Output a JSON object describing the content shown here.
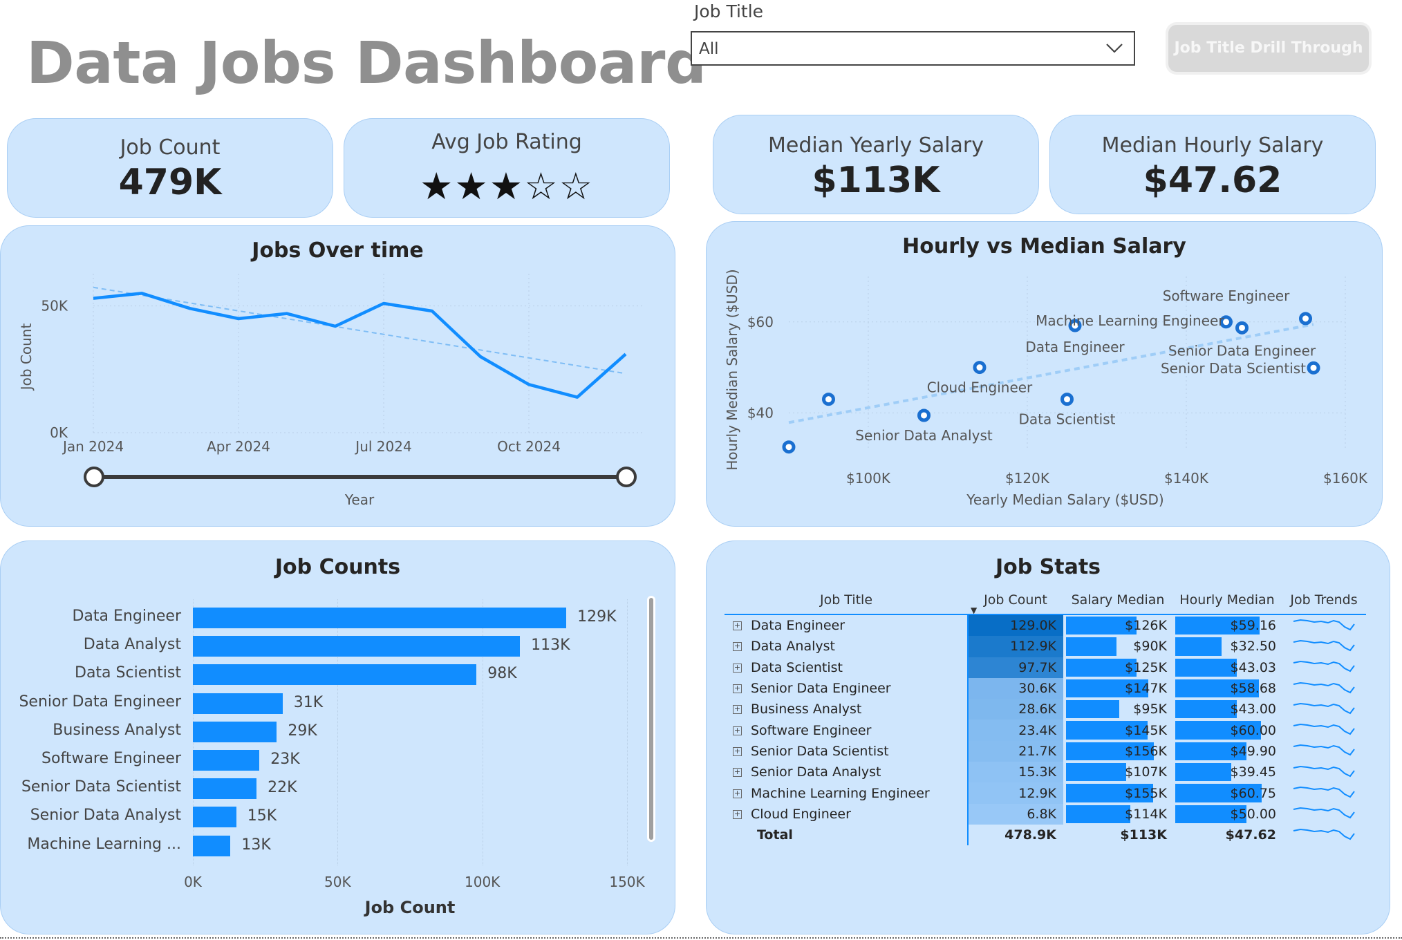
{
  "header": {
    "title": "Data Jobs Dashboard",
    "filter_label": "Job Title",
    "filter_value": "All",
    "drill_button": "Job Title Drill Through"
  },
  "kpis": {
    "job_count_label": "Job Count",
    "job_count_value": "479K",
    "rating_label": "Avg Job Rating",
    "rating_stars_filled": 3,
    "rating_stars_total": 5,
    "yearly_label": "Median Yearly Salary",
    "yearly_value": "$113K",
    "hourly_label": "Median Hourly Salary",
    "hourly_value": "$47.62"
  },
  "colors": {
    "accent": "#118dff",
    "card_bg": "#cfe6fd",
    "title_grey": "#8f8f8f"
  },
  "chart_data": [
    {
      "type": "line",
      "title": "Jobs Over time",
      "xlabel": "Year",
      "ylabel": "Job Count",
      "x": [
        "2024-01",
        "2024-02",
        "2024-03",
        "2024-04",
        "2024-05",
        "2024-06",
        "2024-07",
        "2024-08",
        "2024-09",
        "2024-10",
        "2024-11",
        "2024-12"
      ],
      "x_ticks": [
        "Jan 2024",
        "Apr 2024",
        "Jul 2024",
        "Oct 2024"
      ],
      "y_ticks": [
        "0K",
        "50K"
      ],
      "series": [
        {
          "values": [
            53000,
            55000,
            49000,
            45000,
            47000,
            42000,
            51000,
            48000,
            30000,
            19000,
            14000,
            31000
          ]
        }
      ],
      "trendline": true,
      "ylim": [
        0,
        60000
      ]
    },
    {
      "type": "scatter",
      "title": "Hourly vs Median Salary",
      "xlabel": "Yearly Median Salary ($USD)",
      "ylabel": "Hourly Median Salary ($USD)",
      "xlim": [
        90000,
        160000
      ],
      "ylim": [
        32,
        70
      ],
      "x_ticks": [
        "$100K",
        "$120K",
        "$140K",
        "$160K"
      ],
      "y_ticks": [
        "$40",
        "$60"
      ],
      "points": [
        {
          "label": "Data Engineer",
          "x": 126000,
          "y": 59.2
        },
        {
          "label": "Machine Learning Engineer",
          "x": 145000,
          "y": 60.0
        },
        {
          "label": "Software Engineer",
          "x": 155000,
          "y": 60.75
        },
        {
          "label": "Senior Data Engineer",
          "x": 147000,
          "y": 58.7
        },
        {
          "label": "Senior Data Scientist",
          "x": 156000,
          "y": 49.9
        },
        {
          "label": "Cloud Engineer",
          "x": 114000,
          "y": 50.0
        },
        {
          "label": "Data Scientist",
          "x": 125000,
          "y": 43.0
        },
        {
          "label": "Senior Data Analyst",
          "x": 107000,
          "y": 39.45
        },
        {
          "label": "",
          "x": 95000,
          "y": 43.0
        },
        {
          "label": "",
          "x": 90000,
          "y": 32.5
        }
      ],
      "trendline": true
    },
    {
      "type": "bar",
      "title": "Job Counts",
      "xlabel": "Job Count",
      "categories": [
        "Data Engineer",
        "Data Analyst",
        "Data Scientist",
        "Senior Data Engineer",
        "Business Analyst",
        "Software Engineer",
        "Senior Data Scientist",
        "Senior Data Analyst",
        "Machine Learning ..."
      ],
      "values": [
        129000,
        113000,
        98000,
        31000,
        29000,
        23000,
        22000,
        15000,
        13000
      ],
      "value_labels": [
        "129K",
        "113K",
        "98K",
        "31K",
        "29K",
        "23K",
        "22K",
        "15K",
        "13K"
      ],
      "x_ticks": [
        "0K",
        "50K",
        "100K",
        "150K"
      ],
      "xlim": [
        0,
        150000
      ]
    },
    {
      "type": "table",
      "title": "Job Stats",
      "columns": [
        "Job Title",
        "Job Count",
        "Salary Median",
        "Hourly Median",
        "Job Trends"
      ],
      "rows": [
        {
          "title": "Data Engineer",
          "count": "129.0K",
          "count_num": 129.0,
          "salary": "$126K",
          "salary_num": 126,
          "hourly": "$59.16",
          "hourly_num": 59.16
        },
        {
          "title": "Data Analyst",
          "count": "112.9K",
          "count_num": 112.9,
          "salary": "$90K",
          "salary_num": 90,
          "hourly": "$32.50",
          "hourly_num": 32.5
        },
        {
          "title": "Data Scientist",
          "count": "97.7K",
          "count_num": 97.7,
          "salary": "$125K",
          "salary_num": 125,
          "hourly": "$43.03",
          "hourly_num": 43.03
        },
        {
          "title": "Senior Data Engineer",
          "count": "30.6K",
          "count_num": 30.6,
          "salary": "$147K",
          "salary_num": 147,
          "hourly": "$58.68",
          "hourly_num": 58.68
        },
        {
          "title": "Business Analyst",
          "count": "28.6K",
          "count_num": 28.6,
          "salary": "$95K",
          "salary_num": 95,
          "hourly": "$43.00",
          "hourly_num": 43.0
        },
        {
          "title": "Software Engineer",
          "count": "23.4K",
          "count_num": 23.4,
          "salary": "$145K",
          "salary_num": 145,
          "hourly": "$60.00",
          "hourly_num": 60.0
        },
        {
          "title": "Senior Data Scientist",
          "count": "21.7K",
          "count_num": 21.7,
          "salary": "$156K",
          "salary_num": 156,
          "hourly": "$49.90",
          "hourly_num": 49.9
        },
        {
          "title": "Senior Data Analyst",
          "count": "15.3K",
          "count_num": 15.3,
          "salary": "$107K",
          "salary_num": 107,
          "hourly": "$39.45",
          "hourly_num": 39.45
        },
        {
          "title": "Machine Learning Engineer",
          "count": "12.9K",
          "count_num": 12.9,
          "salary": "$155K",
          "salary_num": 155,
          "hourly": "$60.75",
          "hourly_num": 60.75
        },
        {
          "title": "Cloud Engineer",
          "count": "6.8K",
          "count_num": 6.8,
          "salary": "$114K",
          "salary_num": 114,
          "hourly": "$50.00",
          "hourly_num": 50.0
        }
      ],
      "total": {
        "title": "Total",
        "count": "478.9K",
        "salary": "$113K",
        "hourly": "$47.62"
      }
    }
  ]
}
